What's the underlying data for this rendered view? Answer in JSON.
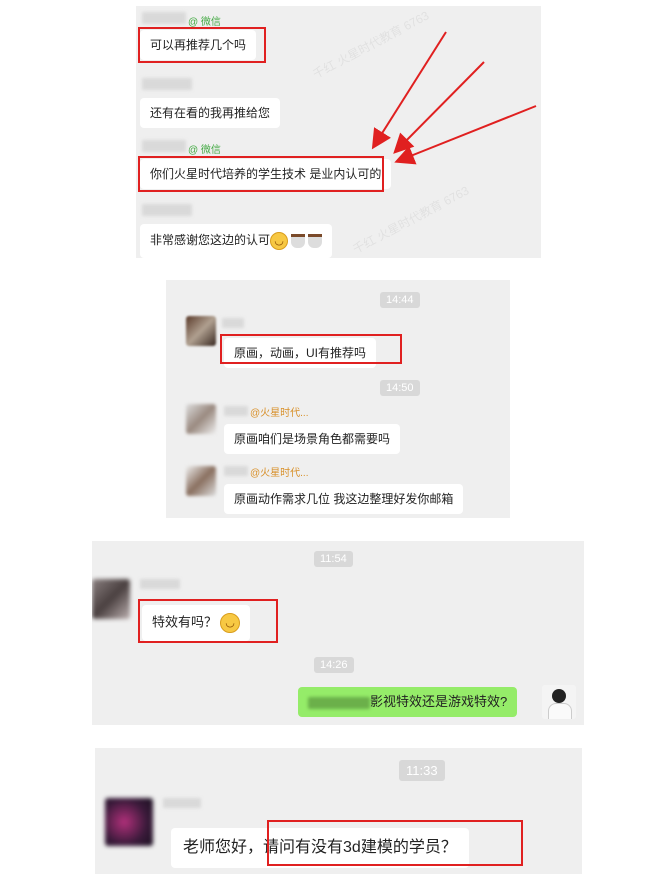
{
  "panel1": {
    "source1": "@ 微信",
    "msg1": "可以再推荐几个吗",
    "msg2": "还有在看的我再推给您",
    "source2": "@ 微信",
    "msg3": "你们火星时代培养的学生技术 是业内认可的",
    "msg4": "非常感谢您这边的认可"
  },
  "panel2": {
    "time1": "14:44",
    "msg1": "原画，动画，UI有推荐吗",
    "time2": "14:50",
    "source1": "@火星时代...",
    "msg2": "原画咱们是场景角色都需要吗",
    "source2": "@火星时代...",
    "msg3": "原画动作需求几位 我这边整理好发你邮箱"
  },
  "panel3": {
    "time1": "11:54",
    "msg1": "特效有吗？",
    "time2": "14:26",
    "msg2": "影视特效还是游戏特效?"
  },
  "panel4": {
    "time1": "11:33",
    "msg_prefix": "老师您好，",
    "msg_highlight": "请问有没有3d建模的学员？"
  },
  "colors": {
    "highlight": "#e02020",
    "bubble_green": "#95ec69",
    "panel_bg": "#efefef"
  }
}
